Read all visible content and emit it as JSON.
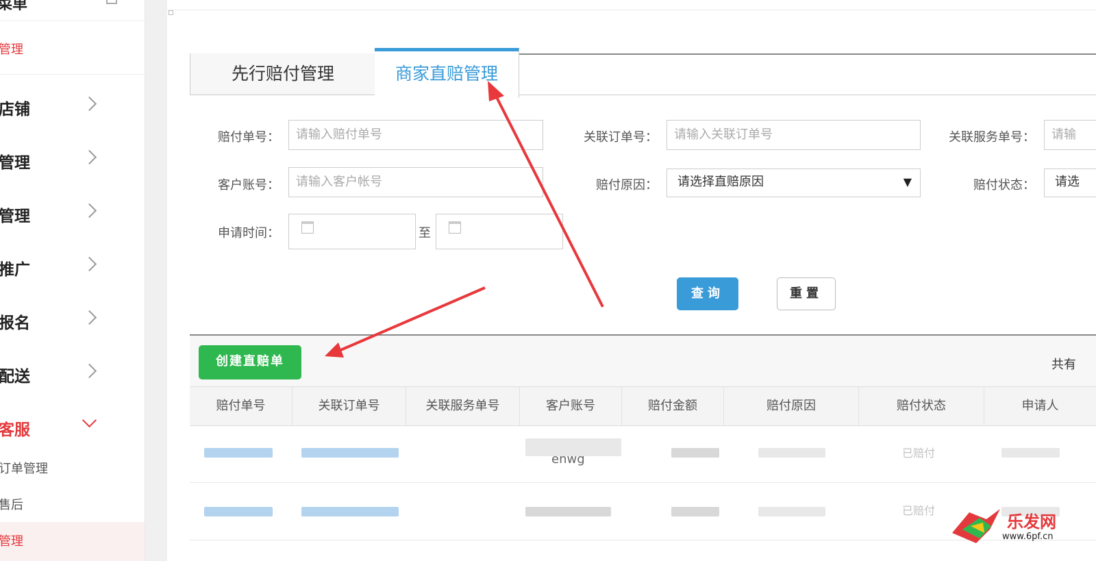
{
  "sidebar": {
    "header_title": "菜单",
    "submenu_top": "管理",
    "items": [
      {
        "label": "店铺"
      },
      {
        "label": "管理"
      },
      {
        "label": "管理"
      },
      {
        "label": "推广"
      },
      {
        "label": "报名"
      },
      {
        "label": "配送"
      },
      {
        "label": "客服"
      }
    ],
    "children": [
      "订单管理",
      "售后",
      "管理"
    ]
  },
  "tabs": [
    {
      "label": "先行赔付管理"
    },
    {
      "label": "商家直赔管理"
    }
  ],
  "filters": {
    "pay_no_label": "赔付单号：",
    "pay_no_placeholder": "请输入赔付单号",
    "order_no_label": "关联订单号：",
    "order_no_placeholder": "请输入关联订单号",
    "service_no_label": "关联服务单号：",
    "service_no_placeholder": "请输",
    "account_label": "客户账号：",
    "account_placeholder": "请输入客户帐号",
    "reason_label": "赔付原因：",
    "reason_value": "请选择直赔原因",
    "status_label": "赔付状态：",
    "status_value": "请选",
    "time_label": "申请时间：",
    "time_sep": "至"
  },
  "buttons": {
    "query": "查询",
    "reset": "重置",
    "create": "创建直赔单"
  },
  "list": {
    "total_prefix": "共有",
    "columns": [
      "赔付单号",
      "关联订单号",
      "关联服务单号",
      "客户账号",
      "赔付金额",
      "赔付原因",
      "赔付状态",
      "申请人"
    ],
    "rows": [
      {
        "account_visible": "enwg",
        "status_visible": "已赔付"
      },
      {
        "status_visible": "已赔付"
      }
    ]
  },
  "watermark": {
    "brand": "乐发网",
    "url": "www.6pf.cn"
  },
  "colors": {
    "accent": "#3a9bd9",
    "create": "#2fb84f",
    "active_nav": "#e4393c",
    "arrow": "#e8383c"
  }
}
